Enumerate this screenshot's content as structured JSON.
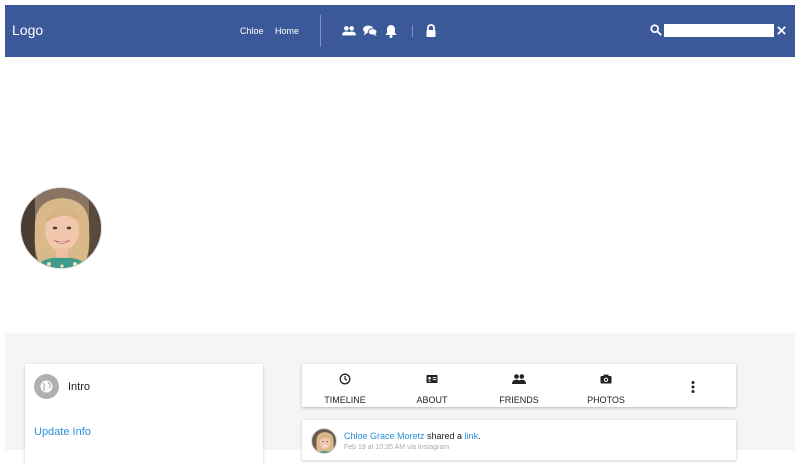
{
  "navbar": {
    "logo": "Logo",
    "links": [
      {
        "label": "Chloe"
      },
      {
        "label": "Home"
      }
    ],
    "icons": [
      "friends-icon",
      "messages-icon",
      "notifications-icon",
      "lock-icon"
    ],
    "search": {
      "icon": "search-icon",
      "value": "",
      "clear_icon": "close-icon"
    },
    "color": "#3b5998"
  },
  "profile": {
    "avatar": "profile-photo"
  },
  "intro": {
    "icon": "globe-icon",
    "title": "Intro",
    "update_link": "Update Info"
  },
  "tabs": [
    {
      "label": "TIMELINE",
      "icon": "clock-icon"
    },
    {
      "label": "ABOUT",
      "icon": "id-card-icon"
    },
    {
      "label": "FRIENDS",
      "icon": "friends-icon"
    },
    {
      "label": "PHOTOS",
      "icon": "camera-icon"
    }
  ],
  "tabs_more_icon": "more-vertical-icon",
  "post": {
    "author": "Chloe Grace Moretz",
    "action": " shared a ",
    "object": "link",
    "end": ".",
    "meta": "Feb 19 at 10:35 AM via Instagram"
  },
  "accent": "#2a8fd8"
}
